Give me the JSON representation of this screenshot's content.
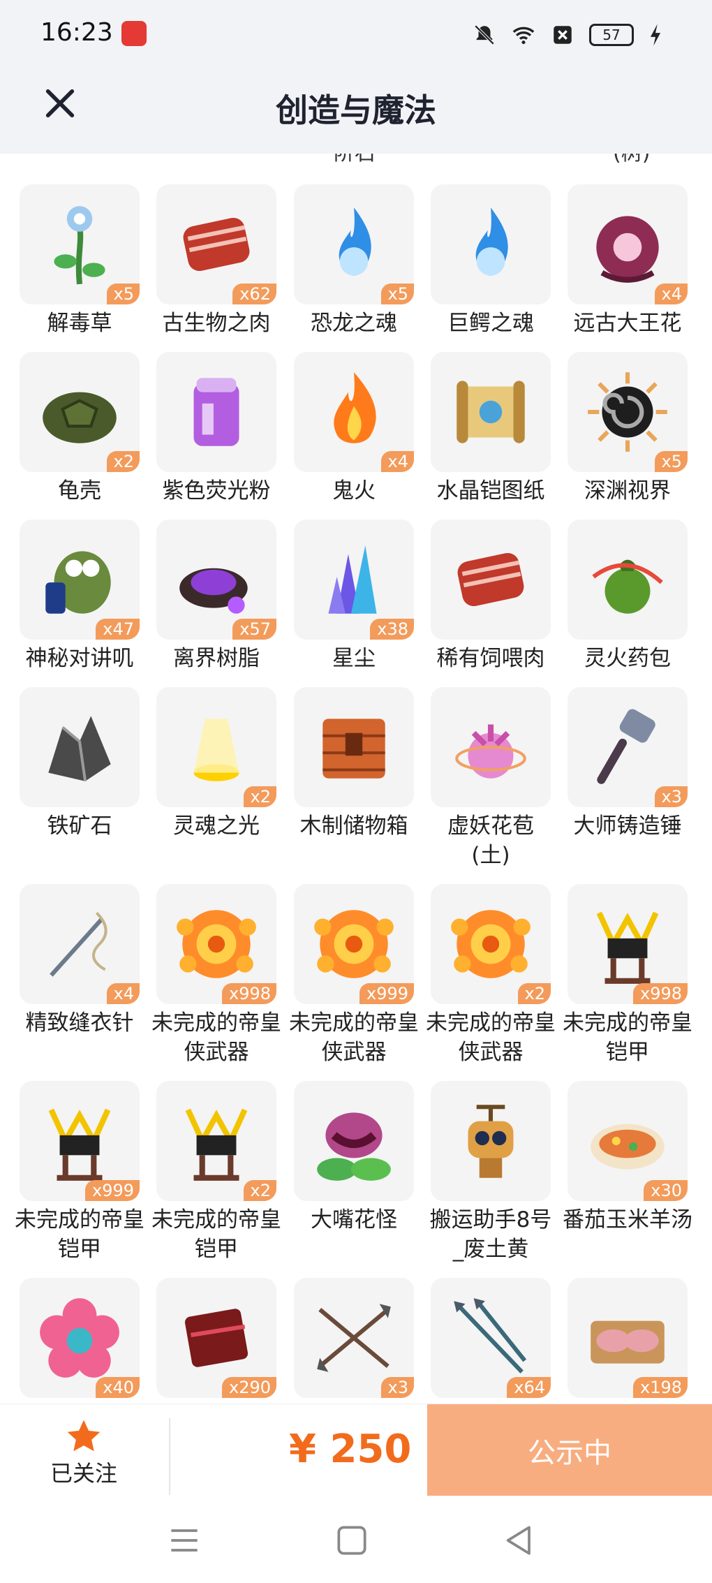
{
  "status_bar": {
    "time": "16:23",
    "battery": "57"
  },
  "header": {
    "title": "创造与魔法"
  },
  "cut_off_labels": [
    "阶石",
    "(树)"
  ],
  "rows": [
    [
      {
        "name": "解毒草",
        "qty": "x5",
        "icon": "flower-icon"
      },
      {
        "name": "古生物之肉",
        "qty": "x62",
        "icon": "meat-icon"
      },
      {
        "name": "恐龙之魂",
        "qty": "x5",
        "icon": "blue-flame-icon"
      },
      {
        "name": "巨鳄之魂",
        "qty": "",
        "icon": "blue-flame-icon"
      },
      {
        "name": "远古大王花",
        "qty": "x4",
        "icon": "rafflesia-icon"
      }
    ],
    [
      {
        "name": "龟壳",
        "qty": "x2",
        "icon": "turtle-shell-icon"
      },
      {
        "name": "紫色荧光粉",
        "qty": "",
        "icon": "purple-jar-icon"
      },
      {
        "name": "鬼火",
        "qty": "x4",
        "icon": "fire-icon"
      },
      {
        "name": "水晶铠图纸",
        "qty": "",
        "icon": "scroll-icon"
      },
      {
        "name": "深渊视界",
        "qty": "x5",
        "icon": "vortex-icon"
      }
    ],
    [
      {
        "name": "神秘对讲叽",
        "qty": "x47",
        "icon": "bird-radio-icon"
      },
      {
        "name": "离界树脂",
        "qty": "x57",
        "icon": "resin-icon"
      },
      {
        "name": "星尘",
        "qty": "x38",
        "icon": "crystal-icon"
      },
      {
        "name": "稀有饲喂肉",
        "qty": "",
        "icon": "meat-icon"
      },
      {
        "name": "灵火药包",
        "qty": "",
        "icon": "pouch-icon"
      }
    ],
    [
      {
        "name": "铁矿石",
        "qty": "",
        "icon": "ore-icon"
      },
      {
        "name": "灵魂之光",
        "qty": "x2",
        "icon": "light-icon"
      },
      {
        "name": "木制储物箱",
        "qty": "",
        "icon": "wood-box-icon"
      },
      {
        "name": "虚妖花苞\n(土)",
        "qty": "",
        "icon": "bud-icon"
      },
      {
        "name": "大师铸造锤",
        "qty": "x3",
        "icon": "hammer-icon"
      }
    ],
    [
      {
        "name": "精致缝衣针",
        "qty": "x4",
        "icon": "needle-icon"
      },
      {
        "name": "未完成的帝皇侠武器",
        "qty": "x998",
        "icon": "gear-flame-icon"
      },
      {
        "name": "未完成的帝皇侠武器",
        "qty": "x999",
        "icon": "gear-flame-icon"
      },
      {
        "name": "未完成的帝皇侠武器",
        "qty": "x2",
        "icon": "gear-flame-icon"
      },
      {
        "name": "未完成的帝皇铠甲",
        "qty": "x998",
        "icon": "armor-stand-icon"
      }
    ],
    [
      {
        "name": "未完成的帝皇铠甲",
        "qty": "x999",
        "icon": "armor-stand-icon"
      },
      {
        "name": "未完成的帝皇铠甲",
        "qty": "x2",
        "icon": "armor-stand-icon"
      },
      {
        "name": "大嘴花怪",
        "qty": "",
        "icon": "plant-monster-icon"
      },
      {
        "name": "搬运助手8号_废土黄",
        "qty": "",
        "icon": "robot-icon"
      },
      {
        "name": "番茄玉米羊汤",
        "qty": "x30",
        "icon": "soup-icon"
      }
    ],
    [
      {
        "name": "",
        "qty": "x40",
        "icon": "flower-badge-icon"
      },
      {
        "name": "",
        "qty": "x290",
        "icon": "chocolate-box-icon"
      },
      {
        "name": "",
        "qty": "x3",
        "icon": "arrows-icon"
      },
      {
        "name": "",
        "qty": "x64",
        "icon": "spear-arrows-icon"
      },
      {
        "name": "",
        "qty": "x198",
        "icon": "meat-tray-icon"
      }
    ]
  ],
  "bottom_bar": {
    "follow_label": "已关注",
    "price": "¥ 250",
    "status_button": "公示中"
  },
  "colors": {
    "accent": "#f26b1d",
    "qty_badge": "#f39b5b",
    "status_button": "#f8ad80",
    "header_bg": "#f1f3f7"
  }
}
